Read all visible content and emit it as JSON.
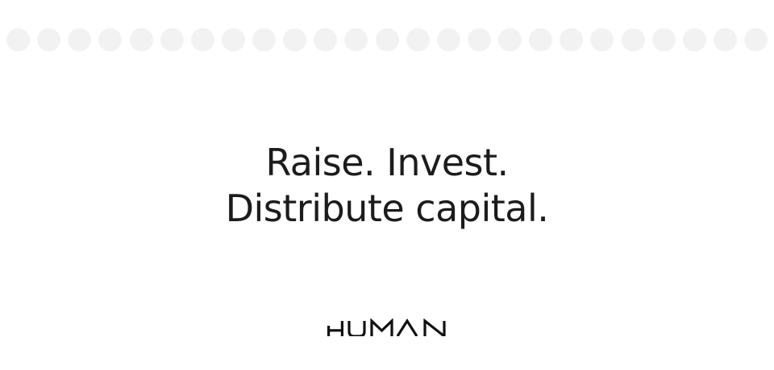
{
  "headline": {
    "line1": "Raise. Invest.",
    "line2": "Distribute capital."
  },
  "logo": {
    "text": "HUMAN"
  },
  "decoration": {
    "dot_count": 25,
    "dot_color": "#f2f2f2"
  },
  "colors": {
    "text": "#1c1c1c",
    "background": "#ffffff"
  }
}
